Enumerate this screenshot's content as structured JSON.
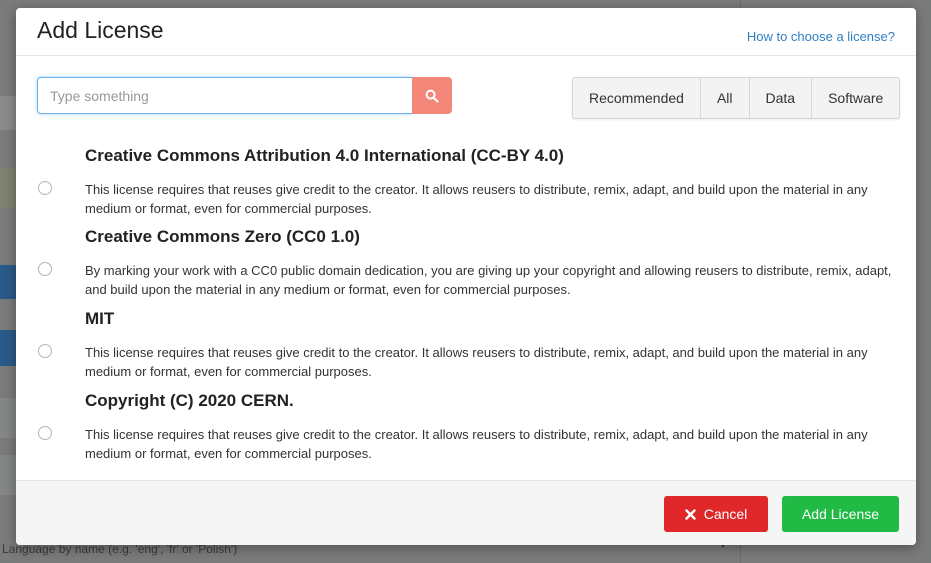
{
  "background": {
    "bottom_text": "Language by name (e.g. 'eng', 'fr' or 'Polish')"
  },
  "modal": {
    "title": "Add License",
    "help_link": "How to choose a license?"
  },
  "search": {
    "placeholder": "Type something",
    "icon": "search-icon"
  },
  "filters": [
    {
      "label": "Recommended"
    },
    {
      "label": "All"
    },
    {
      "label": "Data"
    },
    {
      "label": "Software"
    }
  ],
  "licenses": [
    {
      "title": "Creative Commons Attribution 4.0 International (CC-BY 4.0)",
      "description": "This license requires that reuses give credit to the creator. It allows reusers to distribute, remix, adapt, and build upon the material in any medium or format, even for commercial purposes."
    },
    {
      "title": "Creative Commons Zero (CC0 1.0)",
      "description": "By marking your work with a CC0 public domain dedication, you are giving up your copyright and allowing reusers to distribute, remix, adapt, and build upon the material in any medium or format, even for commercial purposes."
    },
    {
      "title": "MIT",
      "description": "This license requires that reuses give credit to the creator. It allows reusers to distribute, remix, adapt, and build upon the material in any medium or format, even for commercial purposes."
    },
    {
      "title": "Copyright (C) 2020 CERN.",
      "description": "This license requires that reuses give credit to the creator. It allows reusers to distribute, remix, adapt, and build upon the material in any medium or format, even for commercial purposes."
    }
  ],
  "footer": {
    "cancel_label": "Cancel",
    "add_label": "Add License"
  },
  "colors": {
    "cancel": "#e0272a",
    "add": "#21ba45",
    "search_button": "#f4877a",
    "link": "#2f7fc4"
  }
}
